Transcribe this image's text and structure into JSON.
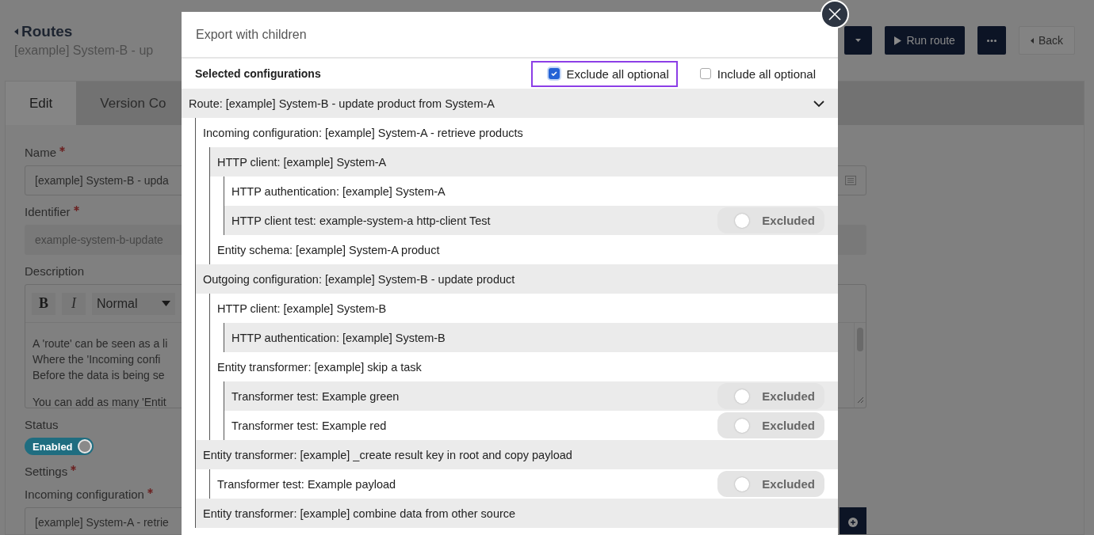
{
  "page": {
    "back_link": "Routes",
    "subtitle": "[example] System-B - up",
    "actions": [
      {
        "kind": "caret"
      },
      {
        "kind": "play",
        "label": "Run route"
      },
      {
        "kind": "more"
      },
      {
        "kind": "back",
        "label": "Back"
      }
    ],
    "tabs": [
      {
        "label": "Edit",
        "selected": true
      },
      {
        "label": "Version Co",
        "selected": false
      }
    ],
    "fields": [
      {
        "kind": "text",
        "label": "Name",
        "required": true,
        "value": "[example] System-B - upda"
      },
      {
        "kind": "readonly",
        "label": "Identifier",
        "required": true,
        "value": "example-system-b-update"
      },
      {
        "kind": "editor",
        "label": "Description",
        "required": false,
        "toolbar": {
          "bold": "B",
          "italic": "I",
          "format": "Normal"
        },
        "paragraphs": [
          [
            "A 'route' can be seen as a li",
            "Where the 'Incoming confi",
            "Before the data is being se"
          ],
          [
            "You can add as many 'Entit"
          ]
        ]
      },
      {
        "kind": "toggle",
        "label": "Status",
        "required": false,
        "on": true,
        "toggle_label": "Enabled"
      },
      {
        "kind": "heading",
        "label": "Settings",
        "required": true
      },
      {
        "kind": "select",
        "label": "Incoming configuration",
        "required": true,
        "value": "[example] System-A - retrie"
      }
    ]
  },
  "dialog": {
    "title": "Export with children",
    "section": "Selected configurations",
    "options": [
      {
        "label": "Exclude all optional",
        "checked": true,
        "highlighted": true
      },
      {
        "label": "Include all optional",
        "checked": false,
        "highlighted": false
      }
    ],
    "tree": [
      {
        "label": "Route: [example] System-B - update product from System-A",
        "expanded": true,
        "children": [
          {
            "label": "Incoming configuration: [example] System-A - retrieve products",
            "children": [
              {
                "label": "HTTP client: [example] System-A",
                "children": [
                  {
                    "label": "HTTP authentication: [example] System-A"
                  },
                  {
                    "label": "HTTP client test: example-system-a http-client Test",
                    "toggle": {
                      "label": "Excluded",
                      "on": false
                    }
                  }
                ]
              },
              {
                "label": "Entity schema: [example] System-A product"
              }
            ]
          },
          {
            "label": "Outgoing configuration: [example] System-B - update product",
            "children": [
              {
                "label": "HTTP client: [example] System-B",
                "children": [
                  {
                    "label": "HTTP authentication: [example] System-B"
                  }
                ]
              },
              {
                "label": "Entity transformer: [example] skip a task",
                "children": [
                  {
                    "label": "Transformer test: Example green",
                    "toggle": {
                      "label": "Excluded",
                      "on": false
                    }
                  },
                  {
                    "label": "Transformer test: Example red",
                    "toggle": {
                      "label": "Excluded",
                      "on": false
                    }
                  }
                ]
              }
            ]
          },
          {
            "label": "Entity transformer: [example] _create result key in root and copy payload",
            "children": [
              {
                "label": "Transformer test: Example payload",
                "toggle": {
                  "label": "Excluded",
                  "on": false
                }
              }
            ]
          },
          {
            "label": "Entity transformer: [example] combine data from other source"
          }
        ]
      }
    ]
  }
}
